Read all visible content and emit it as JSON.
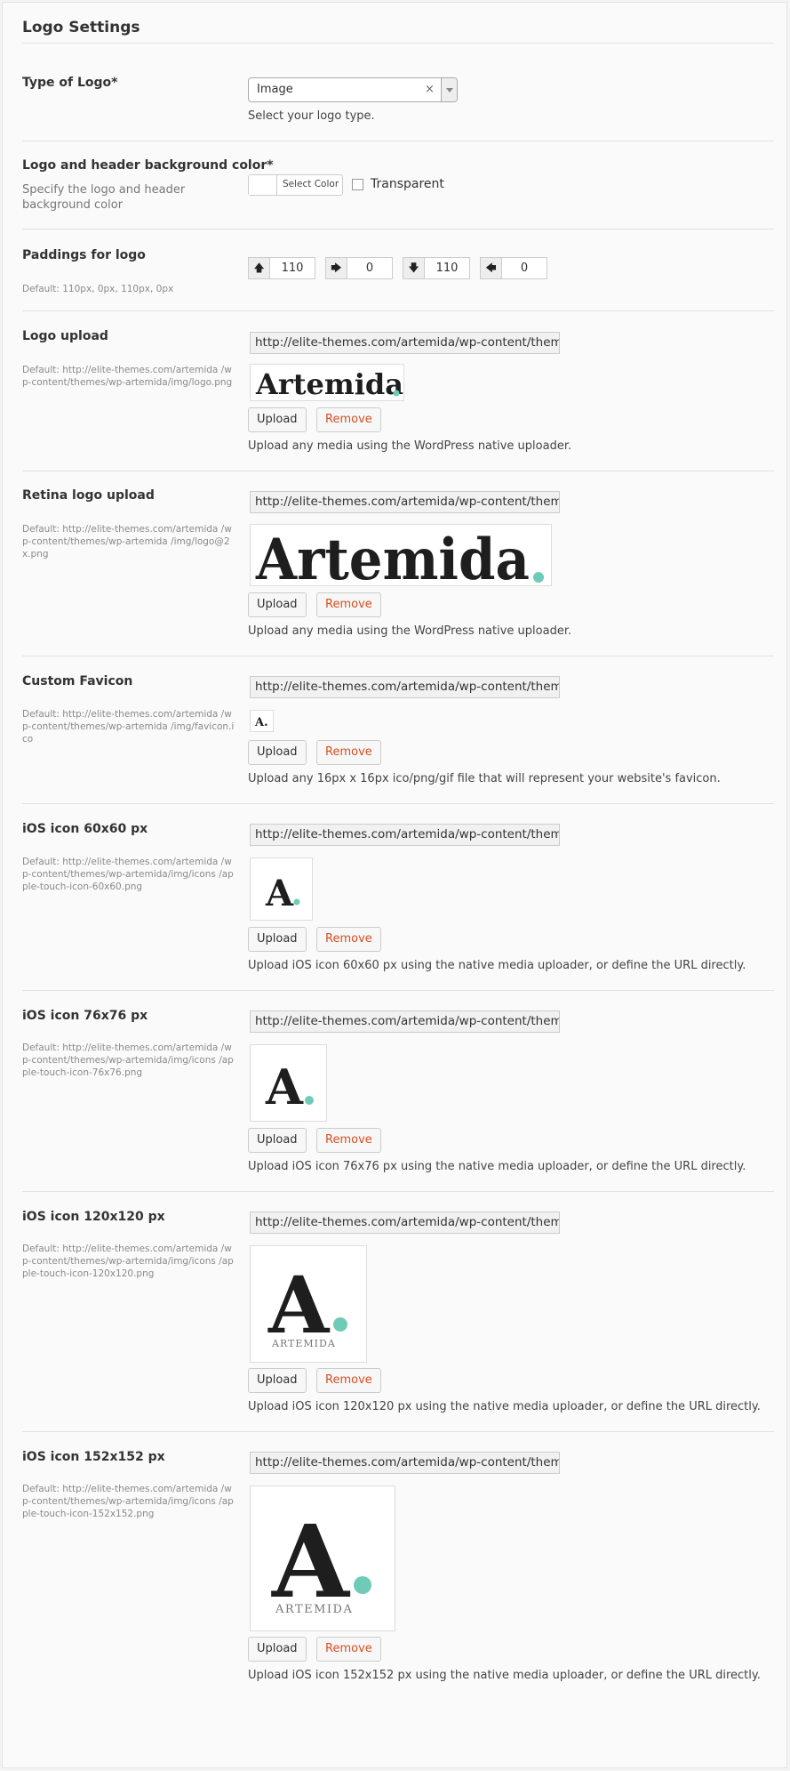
{
  "page_title": "Logo Settings",
  "type_of_logo": {
    "label": "Type of Logo*",
    "selected": "Image",
    "clear_glyph": "×",
    "hint": "Select your logo type."
  },
  "bg_color": {
    "label": "Logo and header background color*",
    "desc": "Specify the logo and header background color",
    "select_color_label": "Select Color",
    "transparent_label": "Transparent"
  },
  "paddings": {
    "label": "Paddings for logo",
    "default": "Default: 110px, 0px, 110px, 0px",
    "values": [
      "110",
      "0",
      "110",
      "0"
    ]
  },
  "buttons": {
    "upload": "Upload",
    "remove": "Remove"
  },
  "logo_upload": {
    "label": "Logo upload",
    "default": "Default: http://elite-themes.com/artemida /wp-content/themes/wp-artemida/img/logo.png",
    "url": "http://elite-themes.com/artemida/wp-content/themes/wp-artemida/img/logo.png",
    "hint": "Upload any media using the WordPress native uploader.",
    "preview_text": "Artemida"
  },
  "retina_logo_upload": {
    "label": "Retina logo upload",
    "default": "Default: http://elite-themes.com/artemida /wp-content/themes/wp-artemida /img/logo@2x.png",
    "url": "http://elite-themes.com/artemida/wp-content/themes/wp-artemida/img/logo@2x.png",
    "hint": "Upload any media using the WordPress native uploader.",
    "preview_text": "Artemida"
  },
  "favicon": {
    "label": "Custom Favicon",
    "default": "Default: http://elite-themes.com/artemida /wp-content/themes/wp-artemida /img/favicon.ico",
    "url": "http://elite-themes.com/artemida/wp-content/themes/wp-artemida/img/favicon.ico",
    "hint": "Upload any 16px x 16px ico/png/gif file that will represent your website's favicon.",
    "preview_text": "A."
  },
  "ios_60": {
    "label": "iOS icon 60x60 px",
    "default": "Default: http://elite-themes.com/artemida /wp-content/themes/wp-artemida/img/icons /apple-touch-icon-60x60.png",
    "url": "http://elite-themes.com/artemida/wp-content/themes/wp-artemida/img/icons/apple-touch-icon-60x60.png",
    "hint": "Upload iOS icon 60x60 px using the native media uploader, or define the URL directly.",
    "preview_text": "A"
  },
  "ios_76": {
    "label": "iOS icon 76x76 px",
    "default": "Default: http://elite-themes.com/artemida /wp-content/themes/wp-artemida/img/icons /apple-touch-icon-76x76.png",
    "url": "http://elite-themes.com/artemida/wp-content/themes/wp-artemida/img/icons/apple-touch-icon-76x76.png",
    "hint": "Upload iOS icon 76x76 px using the native media uploader, or define the URL directly.",
    "preview_text": "A"
  },
  "ios_120": {
    "label": "iOS icon 120x120 px",
    "default": "Default: http://elite-themes.com/artemida /wp-content/themes/wp-artemida/img/icons /apple-touch-icon-120x120.png",
    "url": "http://elite-themes.com/artemida/wp-content/themes/wp-artemida/img/icons/apple-touch-icon-120x120.png",
    "hint": "Upload iOS icon 120x120 px using the native media uploader, or define the URL directly.",
    "preview_text": "A",
    "preview_caption": "ARTEMIDA"
  },
  "ios_152": {
    "label": "iOS icon 152x152 px",
    "default": "Default: http://elite-themes.com/artemida /wp-content/themes/wp-artemida/img/icons /apple-touch-icon-152x152.png",
    "url": "http://elite-themes.com/artemida/wp-content/themes/wp-artemida/img/icons/apple-touch-icon-152x152.png",
    "hint": "Upload iOS icon 152x152 px using the native media uploader, or define the URL directly.",
    "preview_text": "A",
    "preview_caption": "ARTEMIDA"
  },
  "colors": {
    "accent_dot": "#6fcbb8",
    "remove_text": "#d54e21"
  }
}
